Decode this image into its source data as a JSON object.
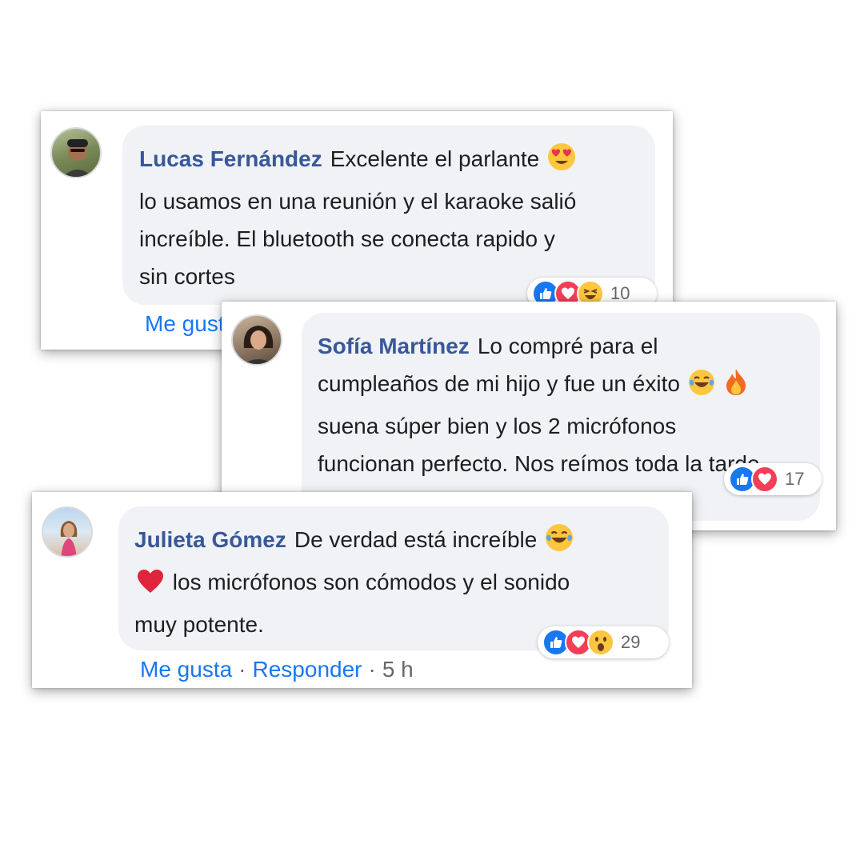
{
  "comments": [
    {
      "author": "Lucas Fernández",
      "line1": "Excelente el parlante",
      "line2": "lo usamos en una reunión y el karaoke salió",
      "line3": "increíble. El bluetooth se conecta rapido y",
      "line4": "sin cortes",
      "reaction_count": "10",
      "like_label": "Me gusta",
      "reactions": [
        "like",
        "love",
        "haha"
      ]
    },
    {
      "author": "Sofía Martínez",
      "line1": "Lo compré para el",
      "line2": "cumpleaños de mi hijo y fue un éxito",
      "line3": "suena súper bien y los 2 micrófonos",
      "line4": "funcionan perfecto. Nos reímos toda la tarde",
      "reaction_count": "17",
      "reactions": [
        "like",
        "love"
      ]
    },
    {
      "author": "Julieta Gómez",
      "line1": "De verdad está increíble",
      "line2": "los micrófonos son cómodos y el sonido",
      "line3": "muy potente.",
      "reaction_count": "29",
      "like_label": "Me gusta",
      "reply_label": "Responder",
      "time": "5 h",
      "reactions": [
        "like",
        "love",
        "wow"
      ]
    }
  ],
  "colors": {
    "author": "#385898",
    "action": "#1877f2",
    "bubble": "#f0f2f5",
    "like": "#1877f2",
    "love": "#f33e58",
    "emoji_yellow": "#fcc63f"
  }
}
